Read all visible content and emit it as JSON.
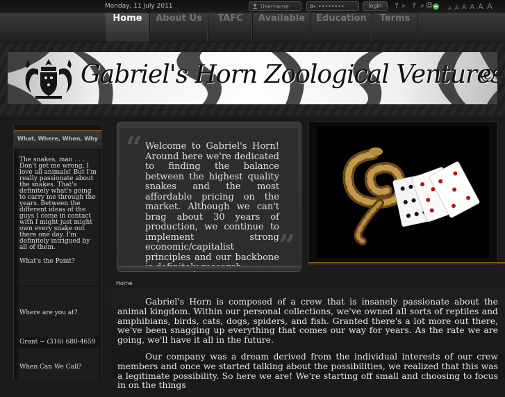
{
  "topbar": {
    "date": "Monday, 11 July 2011",
    "username_placeholder": "Username",
    "password_placeholder": "••••••••",
    "login_label": "login",
    "font_size_controls": [
      "A",
      "A",
      "A",
      "A",
      "A",
      "A"
    ]
  },
  "nav": {
    "items": [
      {
        "label": "Home",
        "active": true
      },
      {
        "label": "About Us",
        "active": false
      },
      {
        "label": "TAFC",
        "active": false
      },
      {
        "label": "Available",
        "active": false
      },
      {
        "label": "Education",
        "active": false
      },
      {
        "label": "Terms",
        "active": false
      }
    ]
  },
  "banner": {
    "title": "Gabriel's Horn Zoological Ventures",
    "symbol": "©"
  },
  "sidebar": {
    "heading": "What, Where, When, Why",
    "about_text": "The snakes, man . . . Don't get me wrong, I love all animals! But I'm really passionate about the snakes. That's definitely what's going to carry me through the years. Between the different ideas of the guys I come in contact with I might just might own every snake out there one day. I'm definitely intrigued by all of them.",
    "point_label": "What's the Point?",
    "where_label": "Where are you at?",
    "contact_line": "Grant   ~ (316) 680-4659",
    "when_label": "When Can We Call?"
  },
  "welcome": {
    "text": "Welcome to Gabriel's Horn! Around here we're dedicated to finding the balance between the highest quality snakes and the most affordable pricing on the market. Although we can't brag about 30 years of production, we continue to implement strong economic/capitalist principles and our backbone is definitely research."
  },
  "breadcrumb": "Home",
  "article": {
    "paragraphs": [
      "Gabriel's Horn is composed of a crew that is insanely passionate about the animal kingdom.  Within our personal collections, we've owned all sorts of reptiles and amphibians, birds, cats, dogs, spiders, and fish.  Granted there's a lot more out there, we've been snagging up everything that comes our way for years.  As the rate we are going, we'll have it all in the future.",
      "Our company was a dream derived from the individual interests of our crew members and once we started talking about the possibilities, we realized that this was a legitimate possibility.  So here we are!  We're starting off small and choosing to focus in on the things"
    ]
  },
  "colors": {
    "accent": "#8a5a12",
    "background": "#1b1b1b",
    "nav_active_text": "#ffffff",
    "nav_text": "#727272"
  }
}
